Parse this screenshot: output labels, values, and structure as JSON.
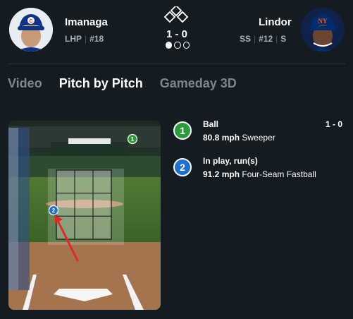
{
  "colors": {
    "background": "#141b21",
    "ball_green": "#2a9d3a",
    "in_play_blue": "#1f6fd1",
    "arrow_red": "#e0282b",
    "muted_text": "#a9b2ba"
  },
  "matchup": {
    "pitcher": {
      "name": "Imanaga",
      "hand": "LHP",
      "number": "#18"
    },
    "batter": {
      "name": "Lindor",
      "position": "SS",
      "number": "#12",
      "bats": "S"
    },
    "count": "1 - 0",
    "outs": 1,
    "outs_total": 3,
    "bases_occupied": []
  },
  "tabs": [
    {
      "label": "Video",
      "active": false
    },
    {
      "label": "Pitch by Pitch",
      "active": true
    },
    {
      "label": "Gameday 3D",
      "active": false
    }
  ],
  "field": {
    "pitch_markers": [
      {
        "number": "1",
        "result": "ball",
        "icon": "green-circle"
      },
      {
        "number": "2",
        "result": "in-play",
        "icon": "blue-circle"
      }
    ],
    "annotation": "red-arrow-icon"
  },
  "pitches": [
    {
      "number": "1",
      "result": "Ball",
      "speed": "80.8 mph",
      "type": "Sweeper",
      "count": "1 - 0",
      "color": "#2a9d3a"
    },
    {
      "number": "2",
      "result": "In play, run(s)",
      "speed": "91.2 mph",
      "type": "Four-Seam Fastball",
      "count": "",
      "color": "#1f6fd1"
    }
  ]
}
